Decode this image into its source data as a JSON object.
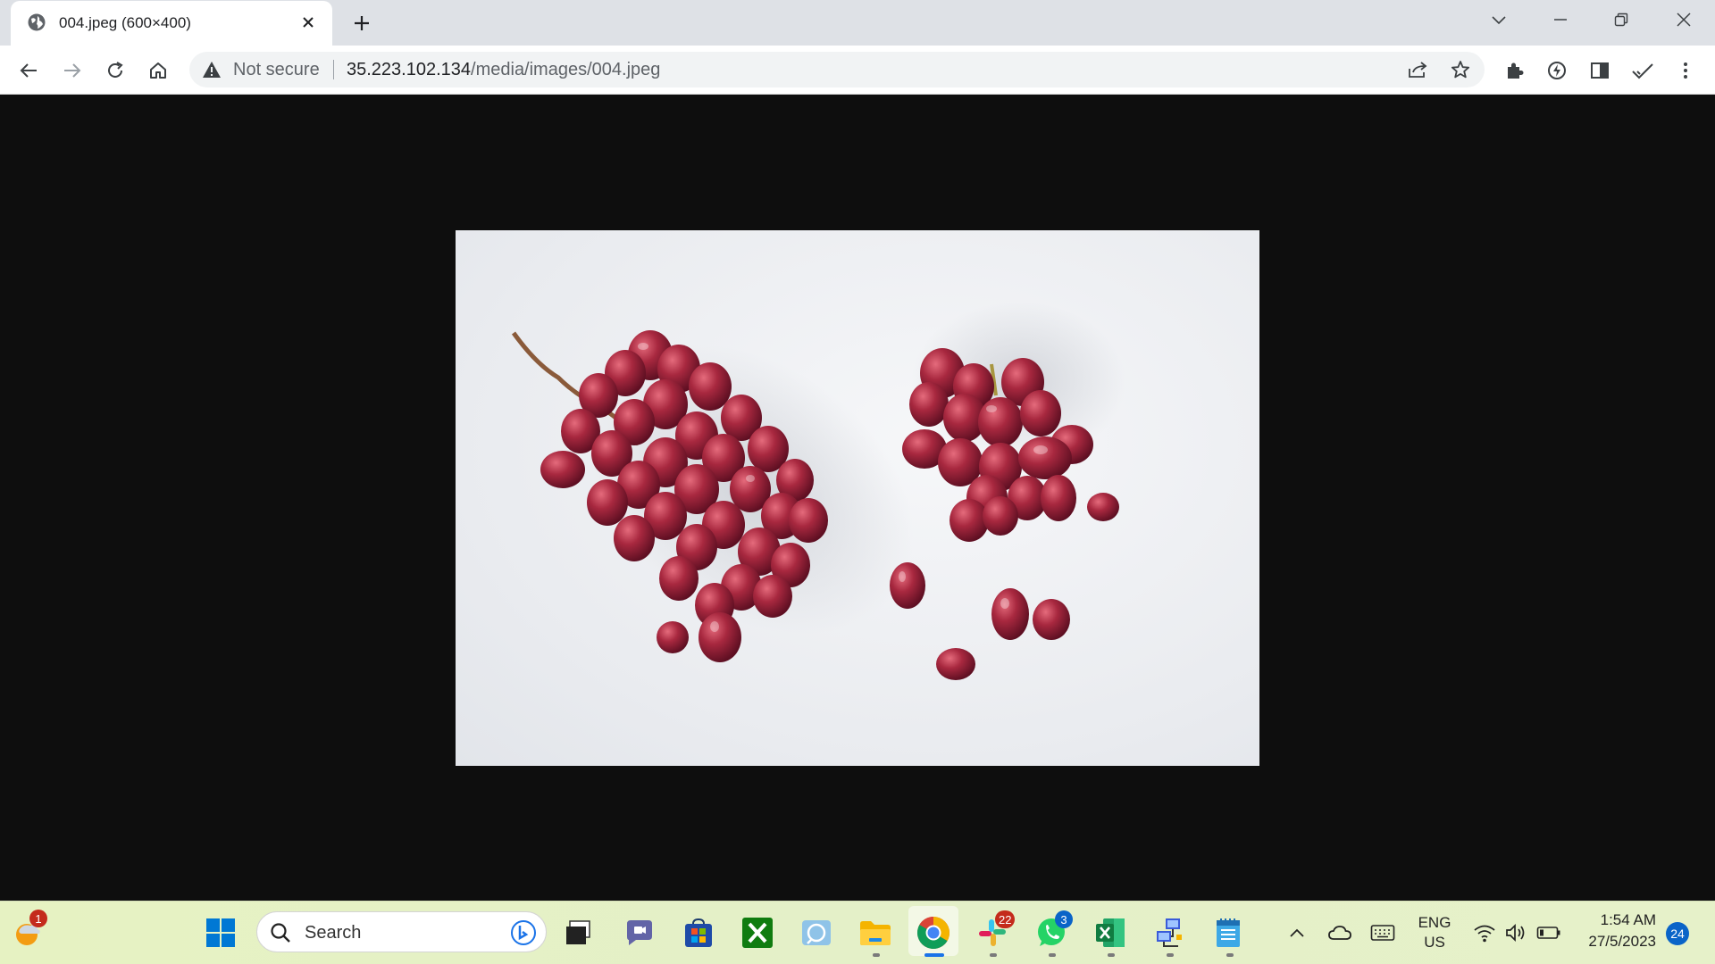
{
  "browser": {
    "tab_title": "004.jpeg (600×400)",
    "omnibox": {
      "security_label": "Not secure",
      "url_host": "35.223.102.134",
      "url_path": "/media/images/004.jpeg"
    }
  },
  "taskbar": {
    "search_placeholder": "Search",
    "widget_badge": "1",
    "slack_badge": "22",
    "whatsapp_badge": "3",
    "language": "ENG",
    "region": "US",
    "time": "1:54 AM",
    "date": "27/5/2023",
    "notification_count": "24"
  },
  "colors": {
    "accent": "#1a73e8",
    "grape": "#9b2335",
    "tab_strip": "#dee1e6",
    "viewer_bg": "#0e0e0e"
  },
  "icons": [
    "globe-icon",
    "close-icon",
    "plus-icon",
    "chevron-down-icon",
    "minimize-icon",
    "restore-icon",
    "back-icon",
    "forward-icon",
    "reload-icon",
    "home-icon",
    "warning-icon",
    "share-icon",
    "star-icon",
    "extensions-icon",
    "sidepanel-icon",
    "check-icon",
    "menu-icon",
    "windows-icon",
    "search-icon",
    "bing-icon",
    "teams-icon",
    "store-icon",
    "xbox-icon",
    "files-icon",
    "chrome-icon",
    "slack-icon",
    "whatsapp-icon",
    "excel-icon",
    "network-icon",
    "notepad-icon",
    "wifi-icon",
    "volume-icon",
    "battery-icon",
    "cloud-icon",
    "keyboard-icon"
  ]
}
